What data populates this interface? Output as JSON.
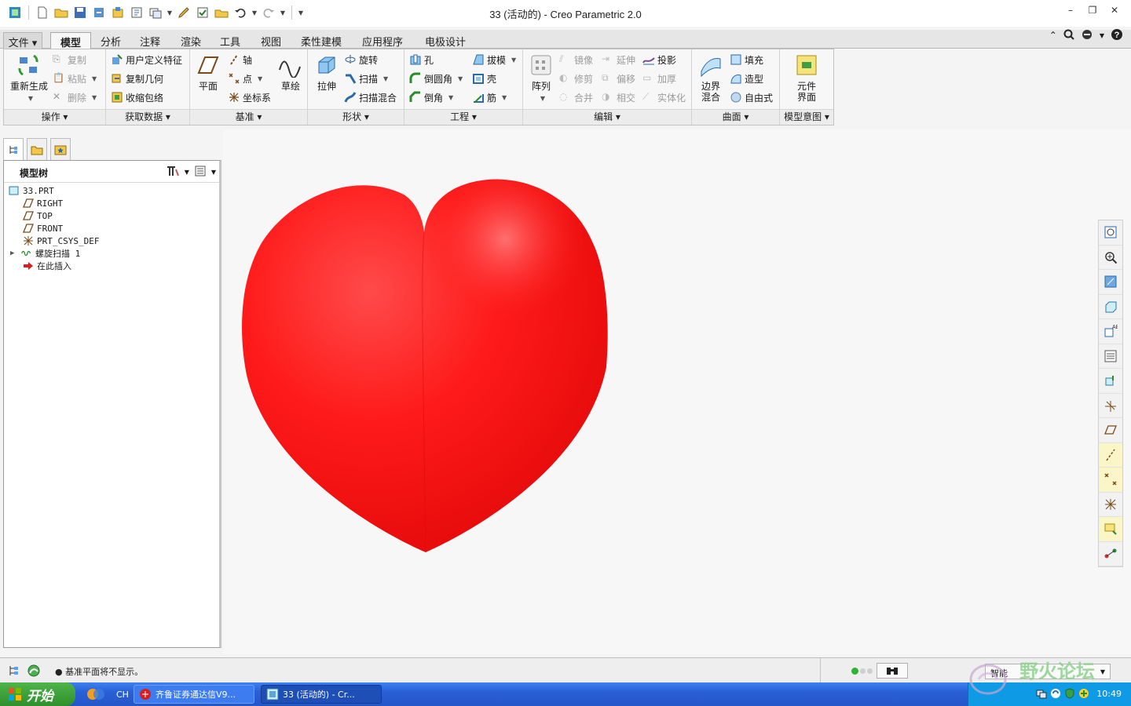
{
  "window": {
    "title": "33 (活动的) - Creo Parametric 2.0",
    "controls": [
      "minimize-icon",
      "restore-icon",
      "close-icon"
    ]
  },
  "ribbon_tabs": [
    "文件",
    "模型",
    "分析",
    "注释",
    "渲染",
    "工具",
    "视图",
    "柔性建模",
    "应用程序",
    "电极设计"
  ],
  "active_tab": "模型",
  "groups": {
    "operations": {
      "label": "操作",
      "regenerate": "重新生成",
      "copy": "复制",
      "paste": "粘贴",
      "delete": "删除",
      "udf": "用户定义特征",
      "copy_geom": "复制几何",
      "shrinkwrap": "收缩包络"
    },
    "get_data": {
      "label": "获取数据"
    },
    "datum": {
      "label": "基准",
      "plane": "平面",
      "axis": "轴",
      "point": "点",
      "csys": "坐标系",
      "sketch": "草绘"
    },
    "shapes": {
      "label": "形状",
      "extrude": "拉伸",
      "revolve": "旋转",
      "sweep": "扫描",
      "swept_blend": "扫描混合"
    },
    "engineering": {
      "label": "工程",
      "hole": "孔",
      "round": "倒圆角",
      "chamfer": "倒角",
      "draft": "拔模",
      "shell": "壳",
      "rib": "筋"
    },
    "editing": {
      "label": "编辑",
      "pattern": "阵列",
      "mirror": "镜像",
      "extend": "延伸",
      "project": "投影",
      "trim": "修剪",
      "offset": "偏移",
      "thicken": "加厚",
      "merge": "合并",
      "intersect": "相交",
      "solidify": "实体化"
    },
    "surfaces": {
      "label": "曲面",
      "boundary_blend_1": "边界",
      "boundary_blend_2": "混合",
      "fill": "填充",
      "style": "造型",
      "freestyle": "自由式"
    },
    "model_intent": {
      "label": "模型意图",
      "component_interface_1": "元件",
      "component_interface_2": "界面"
    }
  },
  "model_tree": {
    "title": "模型树",
    "items": [
      {
        "label": "33.PRT",
        "icon": "part-icon"
      },
      {
        "label": "RIGHT",
        "icon": "datum-plane-icon"
      },
      {
        "label": "TOP",
        "icon": "datum-plane-icon"
      },
      {
        "label": "FRONT",
        "icon": "datum-plane-icon"
      },
      {
        "label": "PRT_CSYS_DEF",
        "icon": "csys-icon"
      },
      {
        "label": "螺旋扫描 1",
        "icon": "helical-sweep-icon"
      },
      {
        "label": "在此插入",
        "icon": "insert-here-arrow-icon"
      }
    ]
  },
  "status": {
    "message": "● 基准平面将不显示。",
    "filter": "智能"
  },
  "taskbar": {
    "start": "开始",
    "lang": "CH",
    "tasks": [
      "齐鲁证券通达信V9...",
      "33 (活动的) - Cr..."
    ],
    "clock": "10:49"
  },
  "watermark": "野火论坛",
  "colors": {
    "heart": "#ff1a1a",
    "accent": "#2a5fd6"
  }
}
